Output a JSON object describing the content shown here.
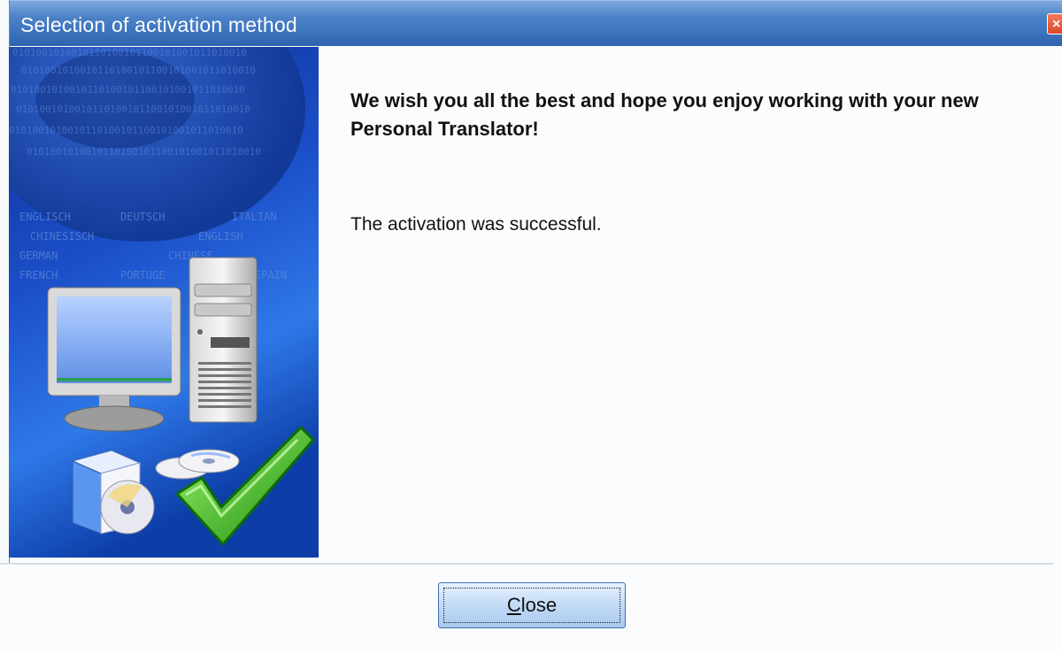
{
  "window": {
    "title": "Selection of activation method",
    "close_glyph": "×"
  },
  "banner": {
    "language_words": [
      "ENGLISCH",
      "DEUTSCH",
      "ITALIAN",
      "CHINESISCH",
      "ENGLISH",
      "GERMAN",
      "CHINESE",
      "FRENCH",
      "PORTUGE",
      "SPAIN"
    ],
    "binary_text": "0101001010010110100101100101001011010010",
    "colors": {
      "deep_blue": "#0a2c8f",
      "mid_blue": "#1f5ed8",
      "check_green": "#39c21f"
    }
  },
  "content": {
    "headline": "We wish you all the best and hope you enjoy working with your new Personal Translator!",
    "status": "The activation was successful."
  },
  "footer": {
    "close_button": {
      "prefix": "",
      "mnemonic": "C",
      "rest": "lose"
    }
  }
}
